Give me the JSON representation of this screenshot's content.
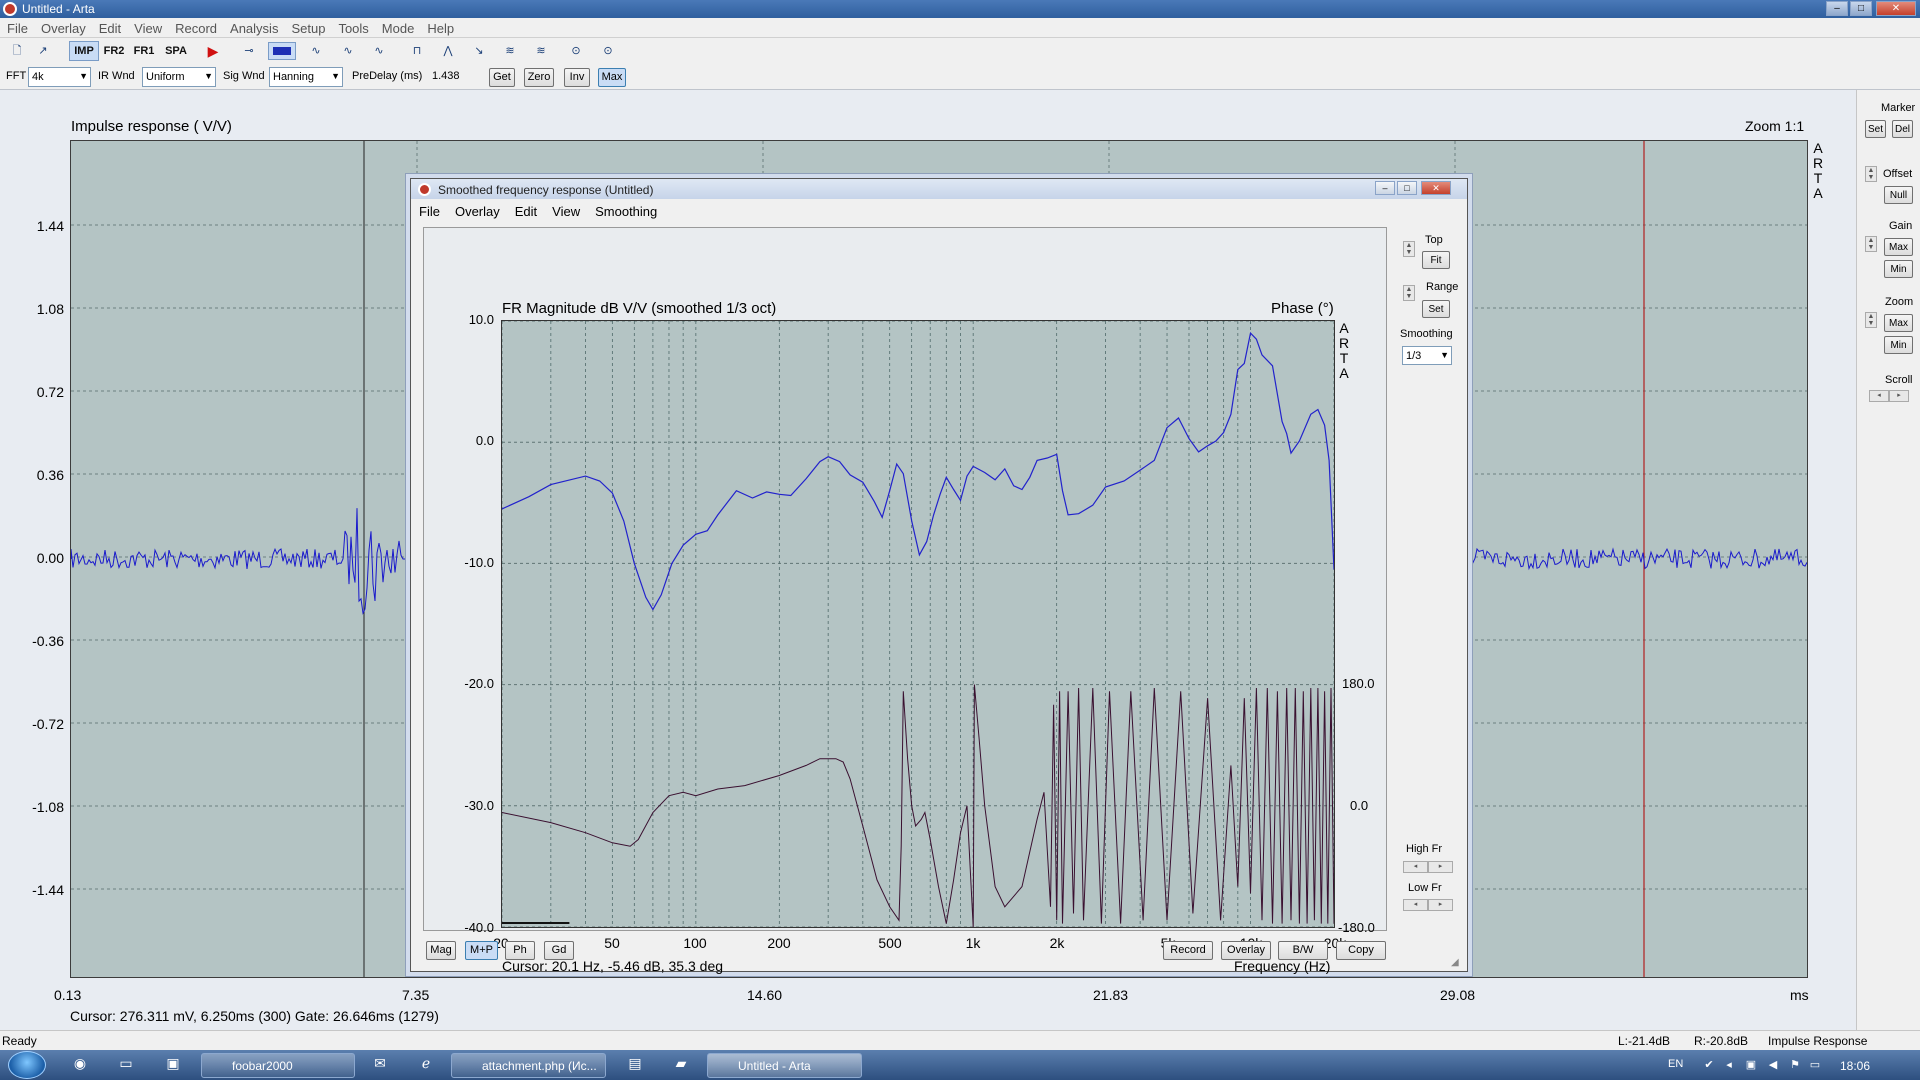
{
  "window": {
    "title": "Untitled - Arta",
    "min": "–",
    "max": "□",
    "close": "✕"
  },
  "menu": [
    "File",
    "Overlay",
    "Edit",
    "View",
    "Record",
    "Analysis",
    "Setup",
    "Tools",
    "Mode",
    "Help"
  ],
  "toolbar": {
    "modes": [
      "IMP",
      "FR2",
      "FR1",
      "SPA"
    ],
    "active_mode": "IMP",
    "fft_label": "FFT",
    "fft_value": "4k",
    "ir_wnd_label": "IR Wnd",
    "ir_wnd_value": "Uniform",
    "sig_wnd_label": "Sig Wnd",
    "sig_wnd_value": "Hanning",
    "predelay_label": "PreDelay (ms)",
    "predelay_value": "1.438",
    "buttons": [
      "Get",
      "Zero",
      "Inv",
      "Max"
    ],
    "active_button": "Max"
  },
  "ir_plot": {
    "title": "Impulse response ( V/V)",
    "zoom": "Zoom 1:1",
    "y_ticks": [
      "1.44",
      "1.08",
      "0.72",
      "0.36",
      "0.00",
      "-0.36",
      "-0.72",
      "-1.08",
      "-1.44"
    ],
    "x_ticks": [
      "0.13",
      "7.35",
      "14.60",
      "21.83",
      "29.08"
    ],
    "x_unit": "ms",
    "watermark": [
      "A",
      "R",
      "T",
      "A"
    ],
    "cursor_text": "Cursor: 276.311 mV, 6.250ms (300)  Gate: 26.646ms (1279)",
    "colors": {
      "plot_bg": "#b4c4c4",
      "trace": "#1a1acc",
      "marker": "#b02020"
    }
  },
  "right_panel": {
    "marker": "Marker",
    "set": "Set",
    "del": "Del",
    "offset": "Offset",
    "null": "Null",
    "gain": "Gain",
    "max": "Max",
    "min": "Min",
    "zoom": "Zoom",
    "scroll": "Scroll"
  },
  "fr_window": {
    "title": "Smoothed frequency response (Untitled)",
    "menu": [
      "File",
      "Overlay",
      "Edit",
      "View",
      "Smoothing"
    ],
    "plot_title": "FR Magnitude dB V/V (smoothed 1/3 oct)",
    "phase_title": "Phase (°)",
    "y_ticks": [
      "10.0",
      "0.0",
      "-10.0",
      "-20.0",
      "-30.0",
      "-40.0"
    ],
    "phase_ticks": [
      "180.0",
      "0.0",
      "-180.0"
    ],
    "x_ticks": [
      "20",
      "50",
      "100",
      "200",
      "500",
      "1k",
      "2k",
      "5k",
      "10k",
      "20k"
    ],
    "x_label": "Frequency (Hz)",
    "cursor": "Cursor: 20.1 Hz, -5.46 dB, 35.3 deg",
    "watermark": [
      "A",
      "R",
      "T",
      "A"
    ],
    "side": {
      "top": "Top",
      "fit": "Fit",
      "range": "Range",
      "set": "Set",
      "smoothing": "Smoothing",
      "smoothing_value": "1/3",
      "high_fr": "High Fr",
      "low_fr": "Low Fr"
    },
    "bottom_left": [
      "Mag",
      "M+P",
      "Ph",
      "Gd"
    ],
    "active_bottom": "M+P",
    "bottom_right": [
      "Record",
      "Overlay",
      "B/W",
      "Copy"
    ],
    "colors": {
      "magnitude": "#2222cc",
      "phase": "#3a1030"
    }
  },
  "statusbar": {
    "ready": "Ready",
    "left_level": "L:-21.4dB",
    "right_level": "R:-20.8dB",
    "mode": "Impulse Response"
  },
  "taskbar": {
    "items": [
      "foobar2000",
      "attachment.php (Ис...",
      "Untitled - Arta"
    ],
    "active": "Untitled - Arta",
    "lang": "EN",
    "clock": "18:06"
  }
}
